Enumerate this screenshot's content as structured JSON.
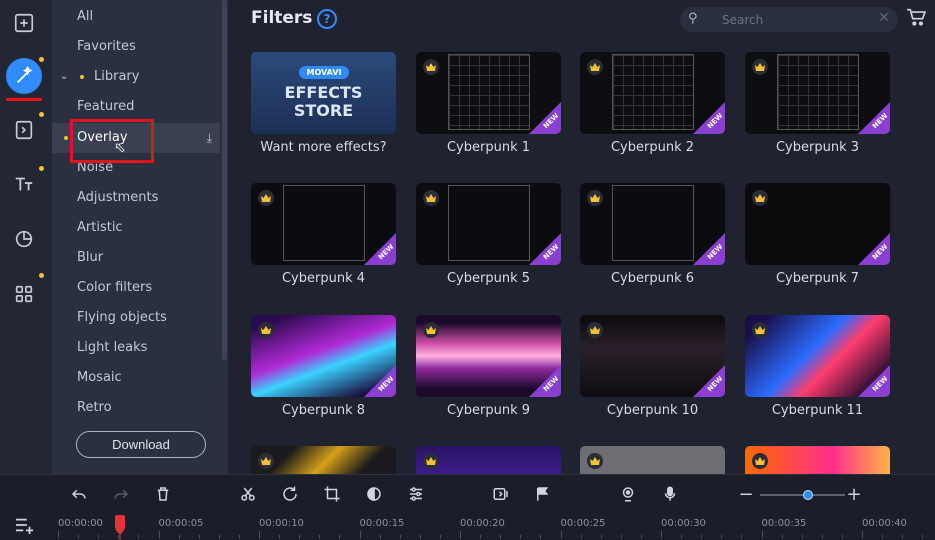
{
  "rail": {
    "icons": [
      "import-icon",
      "filters-magic-icon",
      "transitions-icon",
      "titles-icon",
      "stickers-icon",
      "more-tools-icon"
    ]
  },
  "sidebar": {
    "items": [
      {
        "label": "All"
      },
      {
        "label": "Favorites"
      },
      {
        "label": "Library"
      },
      {
        "label": "Featured"
      },
      {
        "label": "Overlay"
      },
      {
        "label": "Noise"
      },
      {
        "label": "Adjustments"
      },
      {
        "label": "Artistic"
      },
      {
        "label": "Blur"
      },
      {
        "label": "Color filters"
      },
      {
        "label": "Flying objects"
      },
      {
        "label": "Light leaks"
      },
      {
        "label": "Mosaic"
      },
      {
        "label": "Retro"
      }
    ],
    "download_label": "Download"
  },
  "main": {
    "title": "Filters",
    "help": "?",
    "search_placeholder": "Search",
    "store_card": {
      "badge": "MOVAVI",
      "line1": "EFFECTS",
      "line2": "STORE",
      "label": "Want more effects?"
    },
    "ribbon_text": "NEW",
    "cards": [
      {
        "label": "Cyberpunk 1"
      },
      {
        "label": "Cyberpunk 2"
      },
      {
        "label": "Cyberpunk 3"
      },
      {
        "label": "Cyberpunk 4"
      },
      {
        "label": "Cyberpunk 5"
      },
      {
        "label": "Cyberpunk 6"
      },
      {
        "label": "Cyberpunk 7"
      },
      {
        "label": "Cyberpunk 8"
      },
      {
        "label": "Cyberpunk 9"
      },
      {
        "label": "Cyberpunk 10"
      },
      {
        "label": "Cyberpunk 11"
      }
    ]
  },
  "timeline": {
    "ticks": [
      "00:00:00",
      "00:00:05",
      "00:00:10",
      "00:00:15",
      "00:00:20",
      "00:00:25",
      "00:00:30",
      "00:00:35",
      "00:00:40"
    ],
    "zoom_fraction": 0.57,
    "playhead_seconds": 3
  },
  "colors": {
    "accent": "#2f8bff",
    "new_ribbon": "#8a3fd1",
    "highlight_box": "#e0141c",
    "premium_dot": "#f5c13b"
  }
}
